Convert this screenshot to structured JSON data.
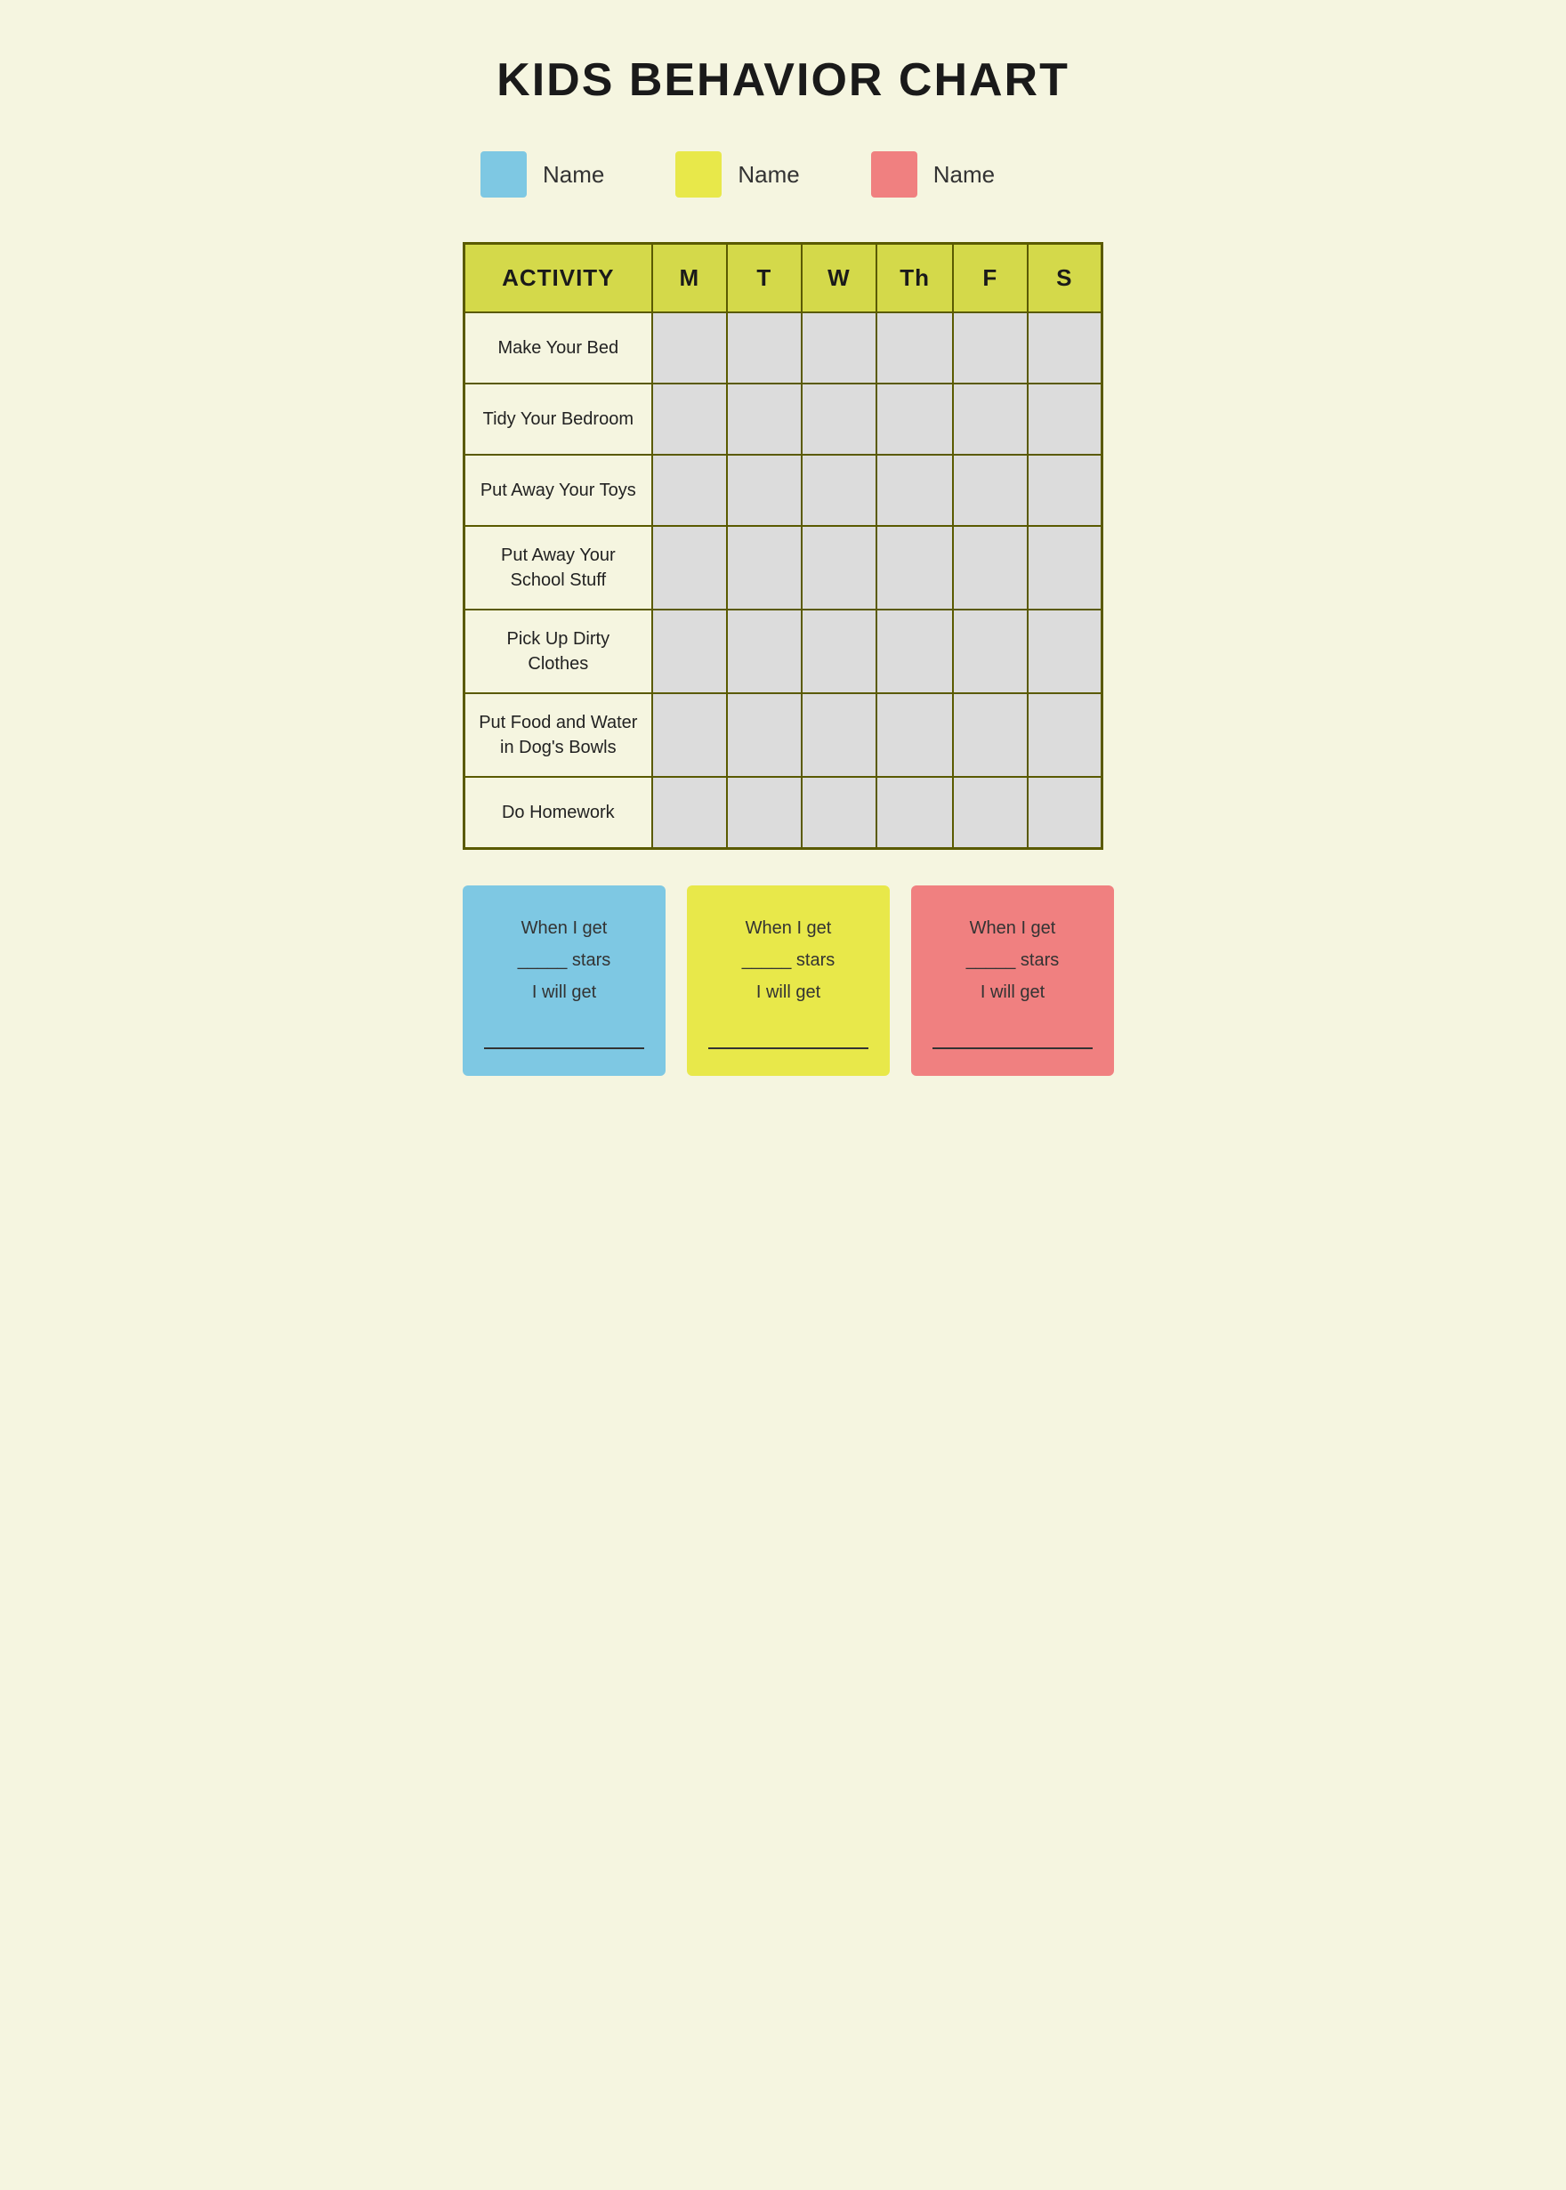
{
  "title": "KIDS BEHAVIOR CHART",
  "legend": {
    "items": [
      {
        "id": "blue",
        "color": "#7ec8e3",
        "label": "Name"
      },
      {
        "id": "yellow",
        "color": "#e8e84a",
        "label": "Name"
      },
      {
        "id": "pink",
        "color": "#f08080",
        "label": "Name"
      }
    ]
  },
  "table": {
    "headers": {
      "activity": "ACTIVITY",
      "days": [
        "M",
        "T",
        "W",
        "Th",
        "F",
        "S"
      ]
    },
    "rows": [
      {
        "activity": "Make Your Bed"
      },
      {
        "activity": "Tidy Your Bedroom"
      },
      {
        "activity": "Put Away Your Toys"
      },
      {
        "activity": "Put Away Your School Stuff"
      },
      {
        "activity": "Pick Up Dirty Clothes"
      },
      {
        "activity": "Put Food and Water in Dog's Bowls"
      },
      {
        "activity": "Do Homework"
      }
    ]
  },
  "rewards": [
    {
      "id": "blue",
      "card_class": "blue-card",
      "line1": "When I get",
      "line2": "_____ stars",
      "line3": "I will get",
      "line4": "_______________"
    },
    {
      "id": "yellow",
      "card_class": "yellow-card",
      "line1": "When I get",
      "line2": "_____ stars",
      "line3": "I will get",
      "line4": "_______________"
    },
    {
      "id": "pink",
      "card_class": "pink-card",
      "line1": "When I get",
      "line2": "_____ stars",
      "line3": "I will get",
      "line4": "_______________"
    }
  ]
}
